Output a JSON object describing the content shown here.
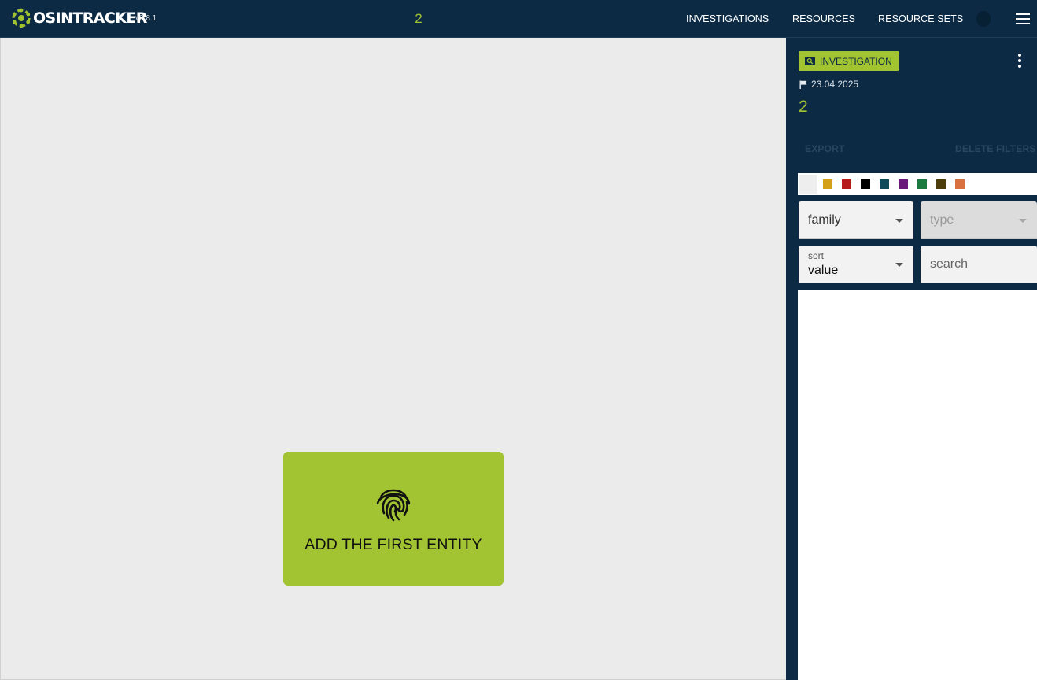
{
  "header": {
    "app_name": "OSINTRACKER",
    "version": "v2.8.1",
    "current_investigation": "2",
    "nav": [
      "INVESTIGATIONS",
      "RESOURCES",
      "RESOURCE SETS"
    ],
    "accent_color": "#a2c332",
    "background_color": "#0c2a44"
  },
  "canvas": {
    "add_entity_label": "ADD THE FIRST ENTITY",
    "add_entity_icon": "fingerprint-icon"
  },
  "panel": {
    "badge_label": "INVESTIGATION",
    "badge_icon": "magnify-icon",
    "date": "23.04.2025",
    "investigation_name": "2",
    "export_label": "EXPORT",
    "delete_filters_label": "DELETE FILTERS",
    "color_filters": [
      "#eeeeee",
      "#d4a017",
      "#b71c1c",
      "#000000",
      "#0e4a5a",
      "#6a1a78",
      "#1a7a40",
      "#4d3d0a",
      "#d97040"
    ],
    "family_select": {
      "placeholder": "family"
    },
    "type_select": {
      "placeholder": "type",
      "disabled": true
    },
    "sort_select": {
      "label": "sort",
      "value": "value"
    },
    "search_input": {
      "placeholder": "search"
    }
  }
}
